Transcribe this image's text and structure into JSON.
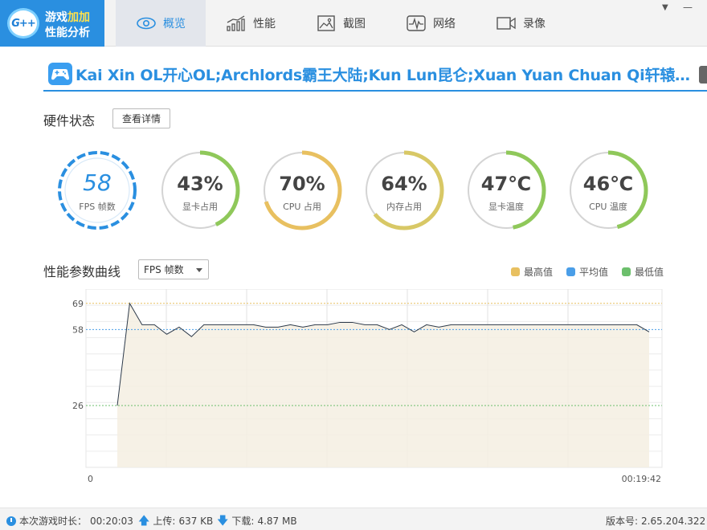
{
  "app": {
    "logo_mark": "G++",
    "name_part1": "游戏",
    "name_part2": "加加",
    "name_line2": "性能分析"
  },
  "tabs": [
    {
      "label": "概览",
      "icon": "eye-icon",
      "active": true
    },
    {
      "label": "性能",
      "icon": "bar-chart-icon",
      "active": false
    },
    {
      "label": "截图",
      "icon": "image-icon",
      "active": false
    },
    {
      "label": "网络",
      "icon": "pulse-icon",
      "active": false
    },
    {
      "label": "录像",
      "icon": "video-camera-icon",
      "active": false
    }
  ],
  "window_controls": {
    "dropdown": "▼",
    "minimize": "—"
  },
  "game": {
    "icon": "gamepad-icon",
    "title": "Kai Xin OL开心OL;Archlords霸王大陆;Kun Lun昆仑;Xuan Yuan Chuan Qi轩辕传..."
  },
  "hardware": {
    "title": "硬件状态",
    "detail_button": "查看详情",
    "gauges": [
      {
        "value": "58",
        "label": "FPS 帧数",
        "fraction": 1.0,
        "color": "#2a8fe0"
      },
      {
        "value": "43%",
        "label": "显卡占用",
        "fraction": 0.43,
        "color": "#8fc85a"
      },
      {
        "value": "70%",
        "label": "CPU 占用",
        "fraction": 0.7,
        "color": "#e8c060"
      },
      {
        "value": "64%",
        "label": "内存占用",
        "fraction": 0.64,
        "color": "#d8c866"
      },
      {
        "value": "47℃",
        "label": "显卡温度",
        "fraction": 0.47,
        "color": "#8fc85a"
      },
      {
        "value": "46℃",
        "label": "CPU 温度",
        "fraction": 0.46,
        "color": "#8fc85a"
      }
    ]
  },
  "curve": {
    "title": "性能参数曲线",
    "select_value": "FPS 帧数",
    "legend": [
      {
        "label": "最高值",
        "color": "#e8c060"
      },
      {
        "label": "平均值",
        "color": "#4a9ee8"
      },
      {
        "label": "最低值",
        "color": "#6cbf6c"
      }
    ]
  },
  "chart_data": {
    "type": "line",
    "series": [
      {
        "values": [
          26,
          69,
          60,
          60,
          56,
          59,
          55,
          60,
          60,
          60,
          60,
          60,
          59,
          59,
          60,
          59,
          60,
          60,
          61,
          61,
          60,
          60,
          58,
          60,
          57,
          60,
          59,
          60,
          60,
          60,
          60,
          60,
          60,
          60,
          60,
          60,
          60,
          60,
          60,
          60,
          60,
          60,
          60,
          57
        ]
      }
    ],
    "reference_lines": {
      "max": 69,
      "avg": 58,
      "min": 26
    },
    "y_tick_labels": [
      "69",
      "58",
      "26",
      "0"
    ],
    "x_label_start": "0",
    "x_label_end": "00:19:42",
    "ylim": [
      0,
      75
    ],
    "grid": true
  },
  "status": {
    "play_time_label": "本次游戏时长：",
    "play_time": "00:20:03",
    "upload_label": "上传:",
    "upload": "637 KB",
    "download_label": "下载:",
    "download": "4.87 MB",
    "version_label": "版本号:",
    "version": "2.65.204.322"
  }
}
